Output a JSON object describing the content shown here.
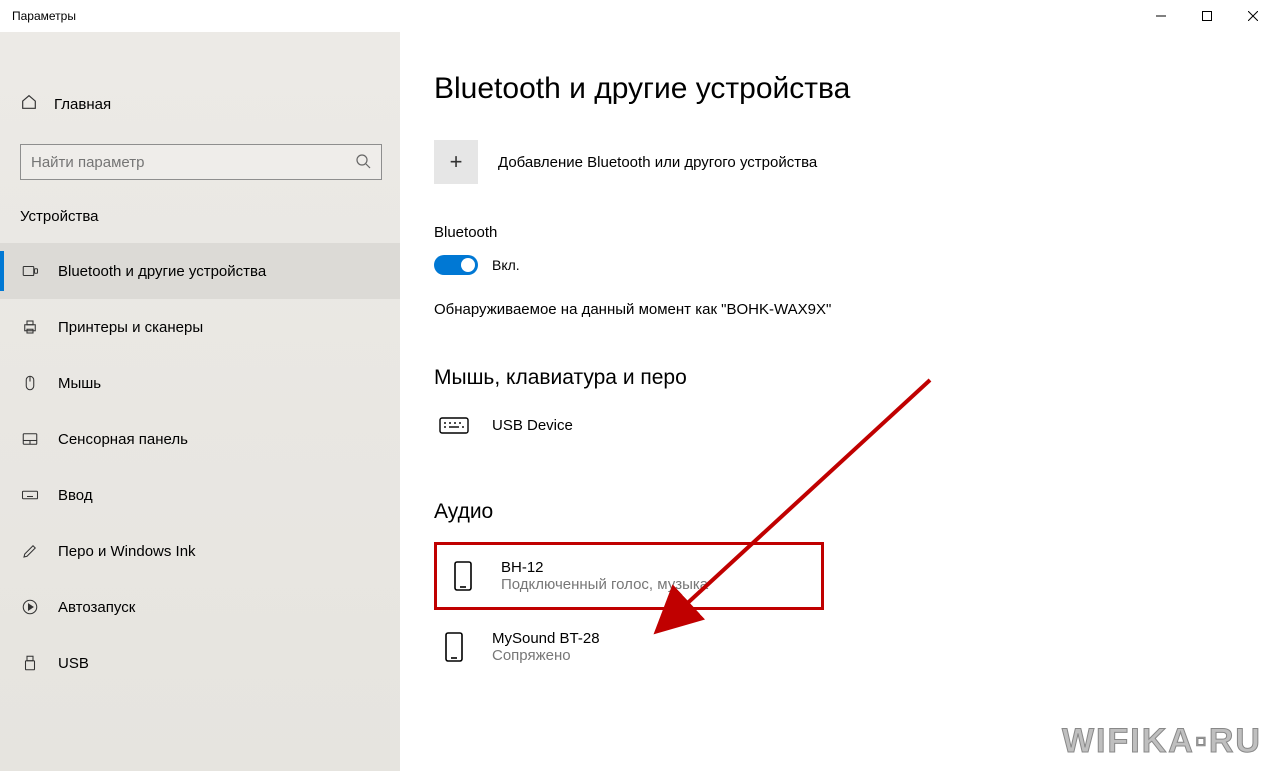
{
  "window": {
    "title": "Параметры"
  },
  "sidebar": {
    "home": "Главная",
    "search_placeholder": "Найти параметр",
    "category": "Устройства",
    "items": [
      {
        "label": "Bluetooth и другие устройства",
        "active": true
      },
      {
        "label": "Принтеры и сканеры"
      },
      {
        "label": "Мышь"
      },
      {
        "label": "Сенсорная панель"
      },
      {
        "label": "Ввод"
      },
      {
        "label": "Перо и Windows Ink"
      },
      {
        "label": "Автозапуск"
      },
      {
        "label": "USB"
      }
    ]
  },
  "main": {
    "title": "Bluetooth и другие устройства",
    "add_label": "Добавление Bluetooth или другого устройства",
    "bluetooth_label": "Bluetooth",
    "toggle_state": "Вкл.",
    "discover_text": "Обнаруживаемое на данный момент как \"BOHK-WAX9X\"",
    "mouse_section": "Мышь, клавиатура и перо",
    "mouse_device": "USB Device",
    "audio_section": "Аудио",
    "audio_devices": [
      {
        "name": "BH-12",
        "status": "Подключенный голос, музыка"
      },
      {
        "name": "MySound BT-28",
        "status": "Сопряжено"
      }
    ]
  },
  "watermark": "WIFIKA▫RU"
}
